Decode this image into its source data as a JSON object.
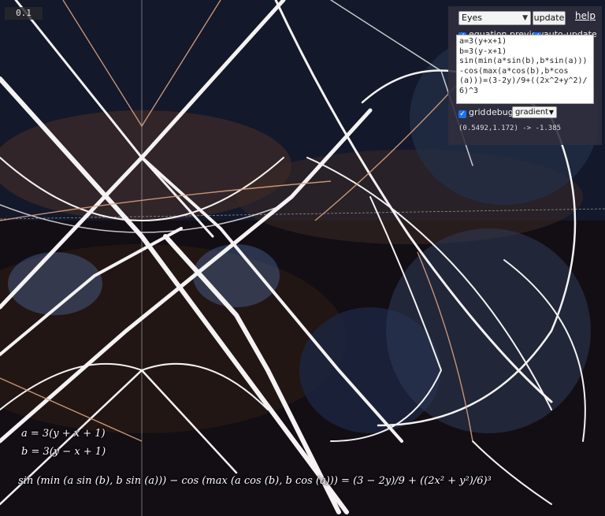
{
  "scale_label": "0.1",
  "controls": {
    "preset_select": "Eyes",
    "update_label": "update",
    "help_label": "help",
    "equation_preview_label": "equation preview",
    "auto_update_label": "auto-update",
    "grid_label": "grid",
    "debug_label": "debug",
    "mode_select": "gradient",
    "equation_source": "a=3(y+x+1)\nb=3(y-x+1)\nsin(min(a*sin(b),b*sin(a)))-cos(max(a*cos(b),b*cos(a)))=(3-2y)/9+((2x^2+y^2)/6)^3",
    "coords_readout": "(0.5492,1.172) -> -1.385"
  },
  "formula": {
    "line_a": "a = 3(y + x + 1)",
    "line_b": "b = 3(y − x + 1)",
    "main": "sin (min (a sin (b), b sin (a))) − cos (max (a cos (b), b cos (a))) = (3 − 2y)/9 + ((2x² + y²)/6)³"
  },
  "colors": {
    "background": "#0c0a10",
    "warm": "#c98a6a",
    "cool": "#7f9cd8",
    "curve": "#ffffff"
  }
}
